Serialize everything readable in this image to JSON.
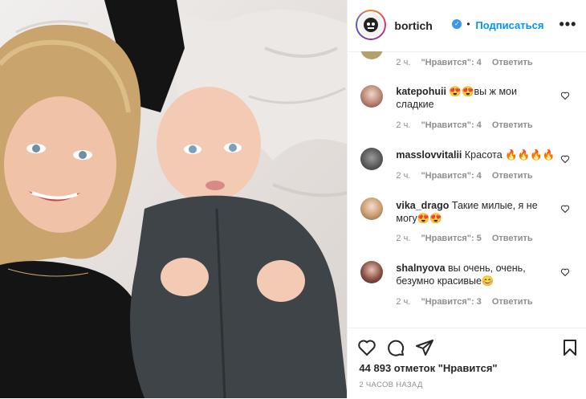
{
  "header": {
    "username": "bortich",
    "verified_icon": "verified-badge-icon",
    "separator": "•",
    "follow_label": "Подписаться",
    "more_label": "•••"
  },
  "comments": [
    {
      "username": "",
      "text": "",
      "time": "2 ч.",
      "likes": "\"Нравится\": 4",
      "reply": "Ответить"
    },
    {
      "username": "katepohuii",
      "text": "😍😍вы ж мои сладкие",
      "time": "2 ч.",
      "likes": "\"Нравится\": 4",
      "reply": "Ответить"
    },
    {
      "username": "masslovvitalii",
      "text": "Красота 🔥🔥🔥🔥",
      "time": "2 ч.",
      "likes": "\"Нравится\": 4",
      "reply": "Ответить"
    },
    {
      "username": "vika_drago",
      "text": "Такие милые, я не могу😍😍",
      "time": "2 ч.",
      "likes": "\"Нравится\": 5",
      "reply": "Ответить"
    },
    {
      "username": "shalnyova",
      "text": "вы очень, очень, безумно красивые😊",
      "time": "2 ч.",
      "likes": "\"Нравится\": 3",
      "reply": "Ответить"
    }
  ],
  "actions": {
    "like_icon": "heart-icon",
    "comment_icon": "comment-icon",
    "share_icon": "send-icon",
    "save_icon": "bookmark-icon"
  },
  "likes_text": "44 893 отметок \"Нравится\"",
  "timestamp": "2 ЧАСОВ НАЗАД",
  "colors": {
    "accent": "#0095f6",
    "verified": "#3897f0",
    "muted": "#8e8e8e",
    "text": "#262626"
  }
}
